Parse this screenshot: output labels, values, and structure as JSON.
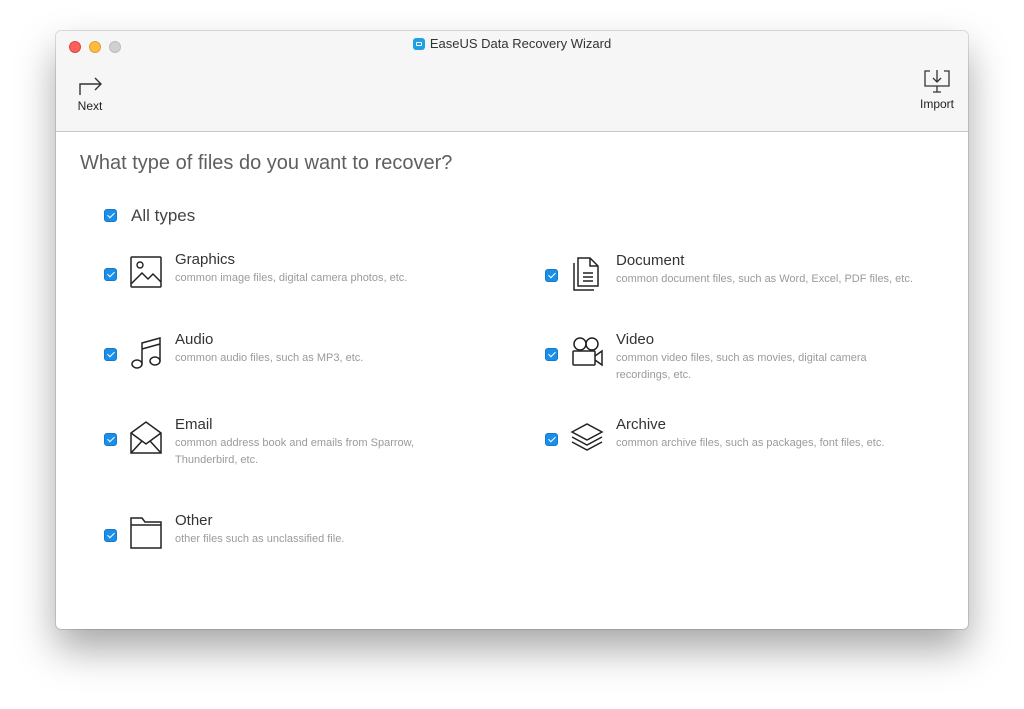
{
  "window": {
    "title": "EaseUS Data Recovery Wizard"
  },
  "toolbar": {
    "next_label": "Next",
    "import_label": "Import"
  },
  "main": {
    "question": "What type of files do you want to recover?",
    "all_types": {
      "label": "All types",
      "checked": true
    },
    "file_types": [
      {
        "name": "Graphics",
        "description": "common image files, digital camera photos, etc.",
        "checked": true,
        "icon": "image-icon"
      },
      {
        "name": "Document",
        "description": "common document files, such as Word, Excel, PDF files, etc.",
        "checked": true,
        "icon": "document-icon"
      },
      {
        "name": "Audio",
        "description": "common audio files, such as MP3, etc.",
        "checked": true,
        "icon": "music-note-icon"
      },
      {
        "name": "Video",
        "description": "common video files, such as movies, digital camera recordings, etc.",
        "checked": true,
        "icon": "video-camera-icon"
      },
      {
        "name": "Email",
        "description": "common address book and emails from Sparrow, Thunderbird, etc.",
        "checked": true,
        "icon": "envelope-icon"
      },
      {
        "name": "Archive",
        "description": "common archive files, such as packages, font files, etc.",
        "checked": true,
        "icon": "layers-icon"
      },
      {
        "name": "Other",
        "description": "other files such as unclassified file.",
        "checked": true,
        "icon": "folder-icon"
      }
    ]
  },
  "colors": {
    "checkbox": "#1a8fea",
    "close": "#fc605c",
    "minimize": "#fdbc40",
    "zoom": "#d0d0d0"
  }
}
